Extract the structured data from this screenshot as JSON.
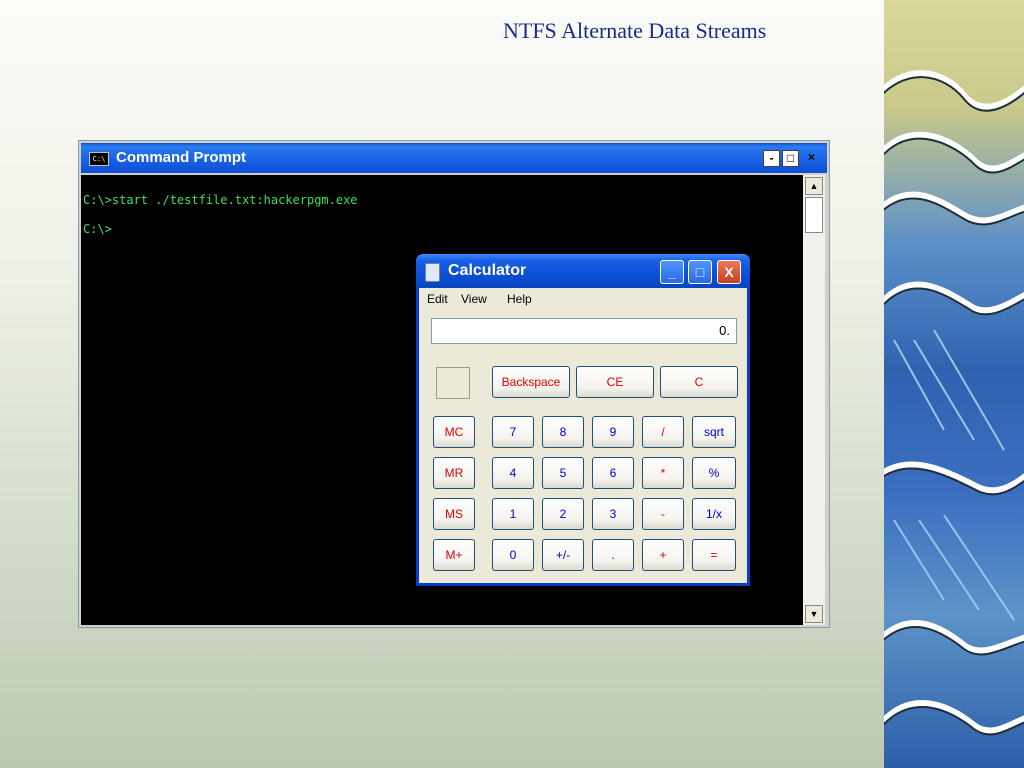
{
  "slide": {
    "title": "NTFS Alternate Data Streams"
  },
  "cmd": {
    "title": "Command Prompt",
    "icon_text": "C:\\",
    "controls": {
      "minimize": "-",
      "maximize": "□",
      "close": "×"
    },
    "lines": [
      "C:\\>start ./testfile.txt:hackerpgm.exe",
      "C:\\>"
    ],
    "scroll_up": "▲",
    "scroll_down": "▼"
  },
  "calculator": {
    "title": "Calculator",
    "menu": [
      "Edit",
      "View",
      "Help"
    ],
    "display": "0.",
    "controls": {
      "minimize": "_",
      "maximize": "□",
      "close": "X"
    },
    "top_buttons": [
      "Backspace",
      "CE",
      "C"
    ],
    "memory_buttons": [
      "MC",
      "MR",
      "MS",
      "M+"
    ],
    "keypad": [
      [
        "7",
        "8",
        "9",
        "/",
        "sqrt"
      ],
      [
        "4",
        "5",
        "6",
        "*",
        "%"
      ],
      [
        "1",
        "2",
        "3",
        "-",
        "1/x"
      ],
      [
        "0",
        "+/-",
        ".",
        "+",
        "="
      ]
    ]
  },
  "colors": {
    "title_text": "#1a2a8a",
    "console_text": "#3de05a",
    "xp_blue": "#0b4fd8",
    "button_red": "#e00000",
    "button_blue": "#0000c8"
  }
}
